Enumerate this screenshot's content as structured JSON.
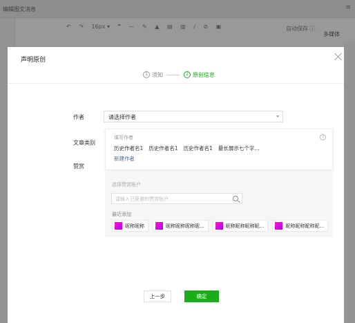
{
  "background": {
    "window_title": "编辑图文消息",
    "toolbar": [
      "↶",
      "↷",
      "16px ▾",
      "❞",
      "—",
      "✎",
      "▲",
      "▤",
      "▥",
      "∕",
      "⊘",
      "▣"
    ],
    "autosave": "自动保存 ⓘ",
    "media_label": "多媒体",
    "menu_icon": "≡"
  },
  "dialog": {
    "title": "声明原创",
    "steps": [
      {
        "num": "1",
        "label": "须知",
        "active": false
      },
      {
        "num": "2",
        "label": "原创信息",
        "active": true
      }
    ],
    "author_label": "作者",
    "author_select": "请选择作者",
    "category_label": "文章类别",
    "reward_label": "赞赏",
    "author_panel": {
      "title": "填写作者",
      "help": "?",
      "history": [
        "历史作者名1",
        "历史作者名1",
        "历史作者名1",
        "最长展示七个字..."
      ],
      "new_author": "新建作者"
    },
    "reward_panel": {
      "title": "选择赞赏账户",
      "search_placeholder": "请输入已获邀的赞赏账户",
      "recent_title": "最近添加",
      "accounts": [
        "昵称昵称",
        "昵称昵称昵称昵...",
        "昵称昵称昵称昵...",
        "昵称昵称昵称昵..."
      ]
    },
    "prev_button": "上一步",
    "ok_button": "确定"
  },
  "colors": {
    "accent": "#1aad19",
    "link": "#576b95",
    "avatar": "#ff16c8"
  }
}
